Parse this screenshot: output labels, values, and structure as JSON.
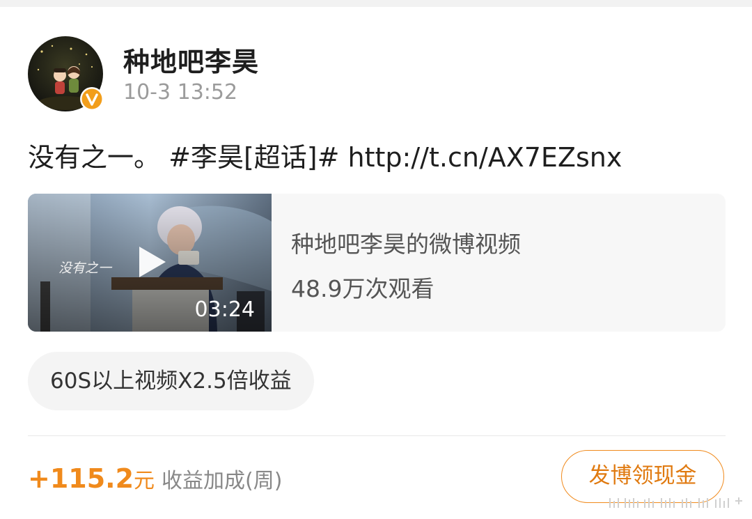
{
  "author": {
    "name": "种地吧李昊",
    "timestamp": "10-3 13:52",
    "verified_badge_char": "v"
  },
  "post": {
    "text_plain": "没有之一。",
    "topic": "#李昊[超话]#",
    "link": "http://t.cn/AX7EZsnx"
  },
  "video": {
    "title": "种地吧李昊的微博视频",
    "views": "48.9万次观看",
    "duration": "03:24",
    "overlay_caption": "没有之一"
  },
  "promo": {
    "label": "60S以上视频X2.5倍收益"
  },
  "earnings": {
    "amount": "+115.2",
    "unit": "元",
    "label": "收益加成(周)"
  },
  "actions": {
    "post_button_label": "发博领现金"
  },
  "colors": {
    "accent_orange": "#f08a1c",
    "badge_orange": "#f29e1b"
  },
  "icons": {
    "play": "play-icon",
    "verified": "verified-badge-icon"
  }
}
